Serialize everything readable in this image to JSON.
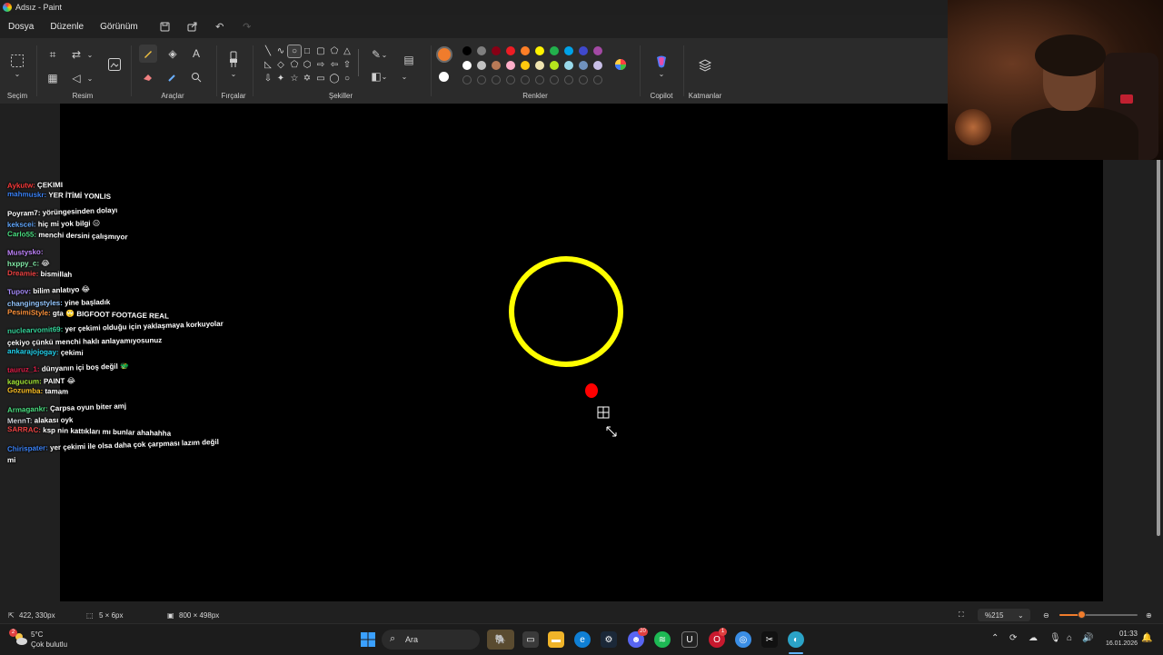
{
  "window": {
    "title": "Adsız - Paint"
  },
  "menu": {
    "file": "Dosya",
    "edit": "Düzenle",
    "view": "Görünüm"
  },
  "ribbon": {
    "selection_label": "Seçim",
    "image_label": "Resim",
    "tools_label": "Araçlar",
    "brushes_label": "Fırçalar",
    "shapes_label": "Şekiller",
    "colors_label": "Renkler",
    "copilot_label": "Copilot",
    "layers_label": "Katmanlar",
    "text_tool_glyph": "A",
    "primary_color": "#f07c2c",
    "secondary_color": "#ffffff",
    "palette_row1": [
      "#000000",
      "#7f7f7f",
      "#880015",
      "#ed1c24",
      "#ff7f27",
      "#fff200",
      "#22b14c",
      "#00a2e8",
      "#3f48cc",
      "#a349a4"
    ],
    "palette_row2": [
      "#ffffff",
      "#c3c3c3",
      "#b97a57",
      "#ffaec9",
      "#ffc90e",
      "#efe4b0",
      "#b5e61d",
      "#99d9ea",
      "#7092be",
      "#c8bfe7"
    ]
  },
  "chat": [
    {
      "user": "Aykutw",
      "user_color": "#ff3b3b",
      "msg": "ÇEKIMI"
    },
    {
      "user": "mahmuskr",
      "user_color": "#3b82f6",
      "msg": "YER İTİMİ YONLIS"
    },
    {
      "user": "Poyram7",
      "user_color": "#ffffff",
      "msg": "yörüngesinden dolayı"
    },
    {
      "user": "kekscei",
      "user_color": "#60a5fa",
      "msg": "hiç mi yok bilgi 😑"
    },
    {
      "user": "Carlo55",
      "user_color": "#4ade80",
      "msg": "menchi dersini çalışmıyor"
    },
    {
      "user": "Mustysko",
      "user_color": "#c084fc",
      "msg": ""
    },
    {
      "user": "hxppy_c",
      "user_color": "#86efac",
      "msg": "😂"
    },
    {
      "user": "Dreamie",
      "user_color": "#ef4444",
      "msg": "bismillah"
    },
    {
      "user": "Tupov",
      "user_color": "#a78bfa",
      "msg": "bilim anlatıyo 😂"
    },
    {
      "user": "changingstyles",
      "user_color": "#93c5fd",
      "msg": "yine başladık"
    },
    {
      "user": "PesimiStyle",
      "user_color": "#fb923c",
      "msg": "gta 🙄 BIGFOOT FOOTAGE REAL"
    },
    {
      "user": "nuclearvomit69",
      "user_color": "#34d399",
      "msg": "yer çekimi olduğu için yaklaşmaya korkuyolar"
    },
    {
      "user": "",
      "user_color": "#ffffff",
      "msg": "çekiyo çünkü menchi haklı anlayamıyosunuz"
    },
    {
      "user": "ankarajojogay",
      "user_color": "#22d3ee",
      "msg": "çekimi"
    },
    {
      "user": "tauruz_1",
      "user_color": "#e11d48",
      "msg": "dünyanın içi boş değil 🐲"
    },
    {
      "user": "kagucum",
      "user_color": "#a3e635",
      "msg": "PAINT 😂"
    },
    {
      "user": "Gozumba",
      "user_color": "#fbbf24",
      "msg": "tamam"
    },
    {
      "user": "Armagankr",
      "user_color": "#4ade80",
      "msg": "Çarpsa oyun biter amj"
    },
    {
      "user": "MennT",
      "user_color": "#d1d5db",
      "msg": "alakası oyk"
    },
    {
      "user": "SARRAC",
      "user_color": "#ef4444",
      "msg": "ksp nin kattıkları mı bunlar ahahahha"
    },
    {
      "user": "Chirispater",
      "user_color": "#3b82f6",
      "msg": "yer çekimi ile olsa daha çok çarpması lazım değil"
    },
    {
      "user": "",
      "user_color": "#ffffff",
      "msg": "mi"
    }
  ],
  "status": {
    "cursor_pos": "422, 330px",
    "selection_size": "5 × 6px",
    "canvas_size": "800 × 498px",
    "zoom": "%215",
    "zoom_slider_fraction": 0.28
  },
  "taskbar": {
    "weather_temp": "5°C",
    "weather_desc": "Çok bulutlu",
    "weather_badge": "2",
    "search_label": "Ara",
    "discord_badge": "20",
    "opera_badge": "1",
    "time": "01:33",
    "date": "16.01.2026"
  }
}
